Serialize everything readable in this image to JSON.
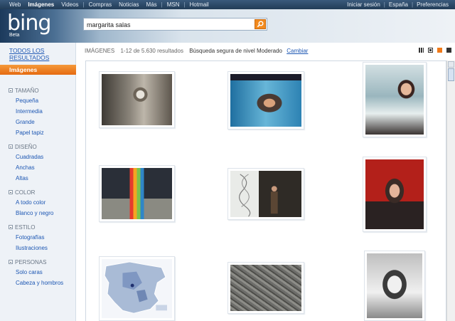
{
  "topnav": {
    "items": [
      "Web",
      "Imágenes",
      "Videos",
      "Compras",
      "Noticias",
      "Más",
      "MSN",
      "Hotmail"
    ],
    "right": [
      "Iniciar sesión",
      "España",
      "Preferencias"
    ]
  },
  "logo": {
    "text": "bing",
    "beta": "Beta"
  },
  "search": {
    "query": "margarita salas"
  },
  "sidebar": {
    "all_results": "TODOS LOS RESULTADOS",
    "active": "Imágenes",
    "groups": [
      {
        "title": "TAMAÑO",
        "items": [
          "Pequeña",
          "Intermedia",
          "Grande",
          "Papel tapiz"
        ]
      },
      {
        "title": "DISEÑO",
        "items": [
          "Cuadradas",
          "Anchas",
          "Altas"
        ]
      },
      {
        "title": "COLOR",
        "items": [
          "A todo color",
          "Blanco y negro"
        ]
      },
      {
        "title": "ESTILO",
        "items": [
          "Fotografías",
          "Ilustraciones"
        ]
      },
      {
        "title": "PERSONAS",
        "items": [
          "Solo caras",
          "Cabeza y hombros"
        ]
      }
    ]
  },
  "results": {
    "label": "IMÁGENES",
    "count": "1-12 de 5.630 resultados",
    "safe": "Búsqueda segura de nivel Moderado",
    "change": "Cambiar"
  },
  "colors": {
    "accent": "#f07a1a",
    "link": "#1d57b3",
    "header": "#223c57"
  }
}
